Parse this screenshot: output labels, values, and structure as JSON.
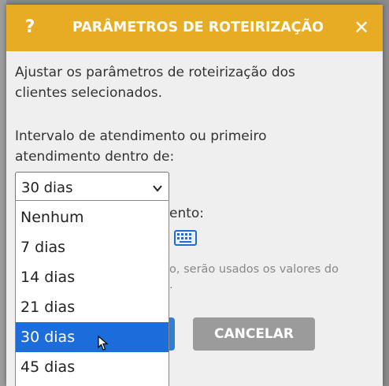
{
  "dialog": {
    "help_label": "?",
    "title": "PARÂMETROS DE ROTEIRIZAÇÃO",
    "close_label": "✕",
    "description_line1": "Ajustar os parâmetros de roteirização dos",
    "description_line2": "clientes selecionados.",
    "interval_label_line1": "Intervalo de atendimento ou primeiro",
    "interval_label_line2": "atendimento dentro de:",
    "interval_select_value": "30 dias",
    "obscured_label_fragment": "ento:",
    "obscured_note_line1": "o, serão usados os valores do",
    "obscured_note_line2": ".",
    "cancel_label": "CANCELAR"
  },
  "dropdown": {
    "options": [
      "Nenhum",
      "7 dias",
      "14 dias",
      "21 dias",
      "30 dias",
      "45 dias"
    ],
    "selected": "30 dias"
  },
  "colors": {
    "header": "#e8ac24",
    "selected_option": "#1a6ddb",
    "confirm_button": "#2f7ed8",
    "cancel_button": "#9b9b9b"
  }
}
